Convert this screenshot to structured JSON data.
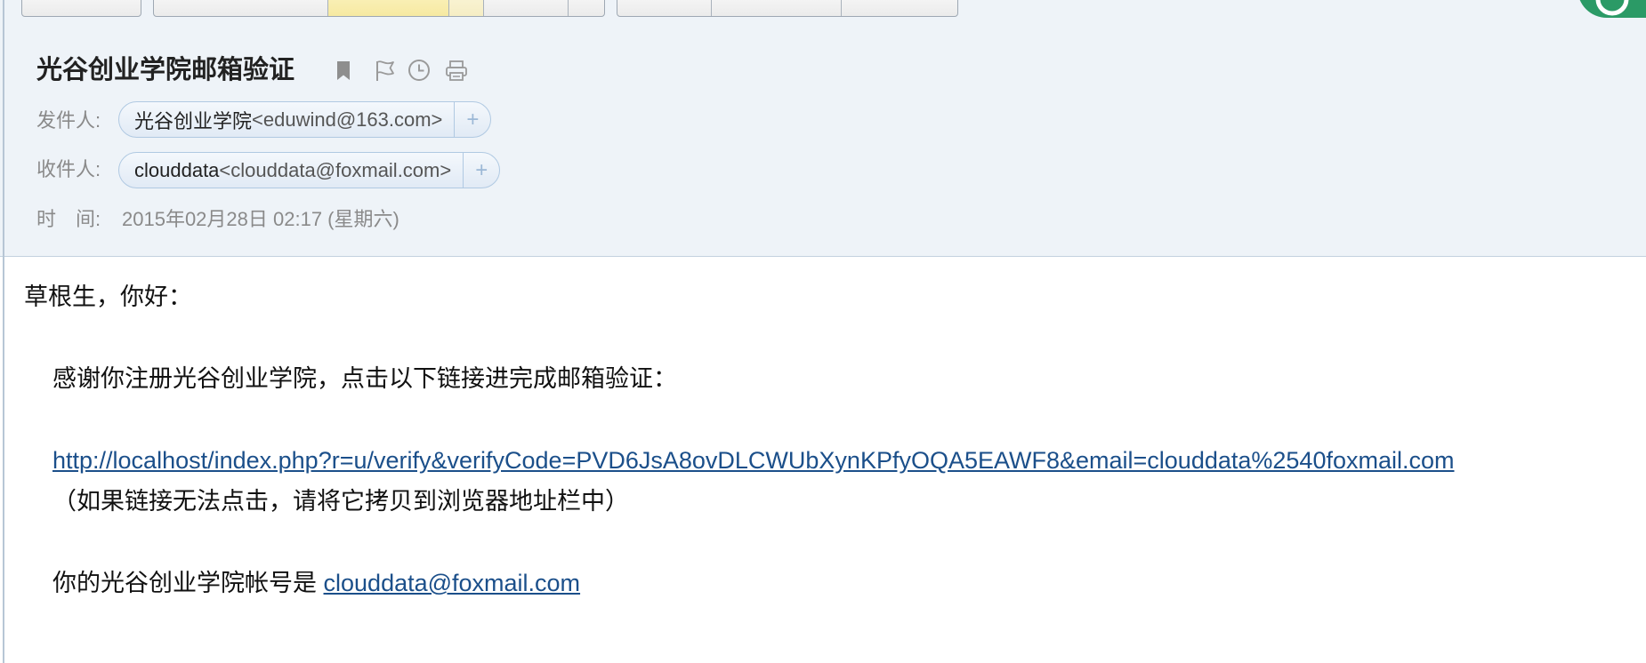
{
  "colors": {
    "header_bg": "#eef3f8",
    "toolbar_highlight": "#fbf0b0",
    "chip_bg": "#e7eff8",
    "chip_border": "#b0c9e2",
    "label_gray": "#8a8a8a",
    "link": "#1b4f8a",
    "badge_green": "#2b9a66"
  },
  "icons": {
    "bookmark": "bookmark-icon",
    "flag": "flag-icon",
    "clock": "clock-icon",
    "print": "print-icon",
    "badge": "floating-badge-icon"
  },
  "mail": {
    "subject": "光谷创业学院邮箱验证",
    "from": {
      "label": "发件人:",
      "name": "光谷创业学院",
      "address": "<eduwind@163.com>",
      "add_label": "+"
    },
    "to": {
      "label": "收件人:",
      "name": "clouddata",
      "address": "<clouddata@foxmail.com>",
      "add_label": "+"
    },
    "time": {
      "label": "时　间:",
      "value": "2015年02月28日 02:17 (星期六)"
    },
    "body": {
      "greeting": "草根生，你好：",
      "intro": "感谢你注册光谷创业学院，点击以下链接进完成邮箱验证：",
      "verify_link": "http://localhost/index.php?r=u/verify&verifyCode=PVD6JsA8ovDLCWUbXynKPfyOQA5EAWF8&email=clouddata%2540foxmail.com",
      "hint": "（如果链接无法点击，请将它拷贝到浏览器地址栏中）",
      "account_prefix": "你的光谷创业学院帐号是 ",
      "account_email": "clouddata@foxmail.com"
    }
  }
}
